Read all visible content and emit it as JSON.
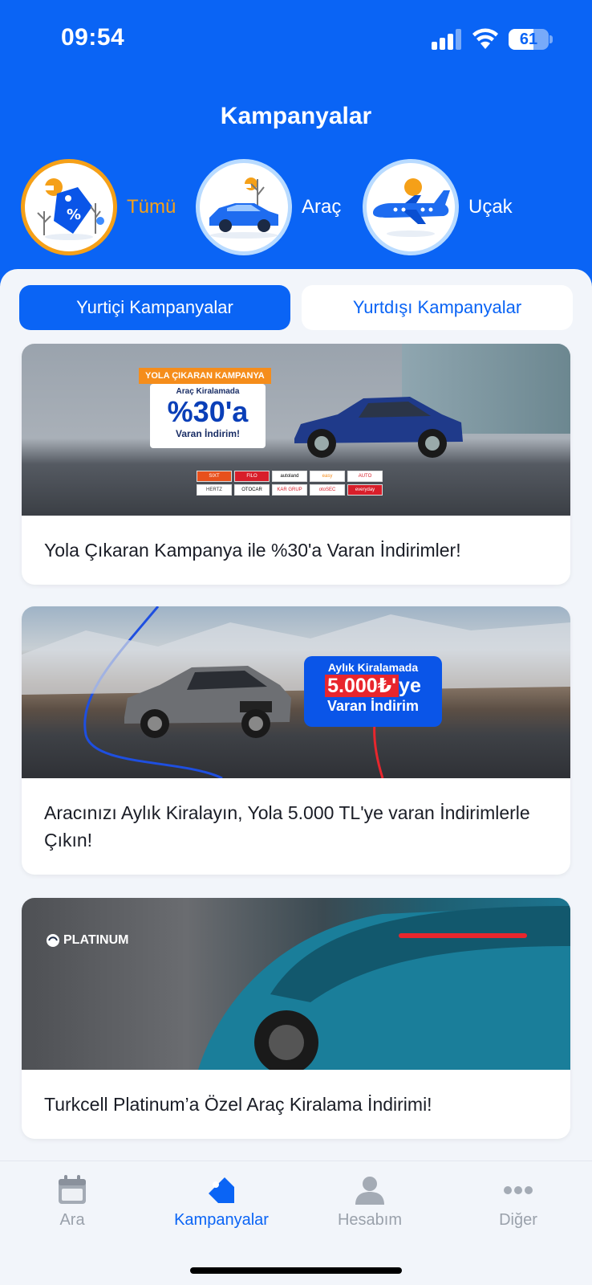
{
  "status": {
    "time": "09:54",
    "battery": "61",
    "battery_level": 0.61
  },
  "header": {
    "title": "Kampanyalar"
  },
  "categories": [
    {
      "label": "Tümü",
      "icon": "tag-icon",
      "active": true
    },
    {
      "label": "Araç",
      "icon": "car-icon",
      "active": false
    },
    {
      "label": "Uçak",
      "icon": "plane-icon",
      "active": false
    }
  ],
  "segments": {
    "domestic": "Yurtiçi Kampanyalar",
    "international": "Yurtdışı Kampanyalar"
  },
  "cards": [
    {
      "title": "Yola Çıkaran Kampanya ile %30'a Varan İndirimler!",
      "banner": {
        "tag": "YOLA ÇIKARAN KAMPANYA",
        "small": "Araç Kiralamada",
        "big": "%30'a",
        "sub": "Varan İndirim!",
        "logos": [
          "SIXT",
          "FILO",
          "autoland",
          "easy",
          "AUTO",
          "OTOCAR",
          "KAR GRUP",
          "otoSEC",
          "everyday",
          "HERTZ"
        ]
      }
    },
    {
      "title": "Aracınızı Aylık Kiralayın, Yola 5.000 TL'ye varan İndirimlerle Çıkın!",
      "banner": {
        "line1": "Aylık Kiralamada",
        "amount": "5.000₺'",
        "suffix": "ye",
        "line3": "Varan İndirim"
      }
    },
    {
      "title": "Turkcell Platinum’a Özel Araç Kiralama İndirimi!",
      "banner": {
        "brand": "PLATINUM"
      }
    }
  ],
  "tabbar": {
    "search": "Ara",
    "campaigns": "Kampanyalar",
    "account": "Hesabım",
    "more": "Diğer"
  },
  "colors": {
    "primary": "#0a64f5",
    "accent": "#f5a018",
    "inactive": "#9aa1ab"
  }
}
